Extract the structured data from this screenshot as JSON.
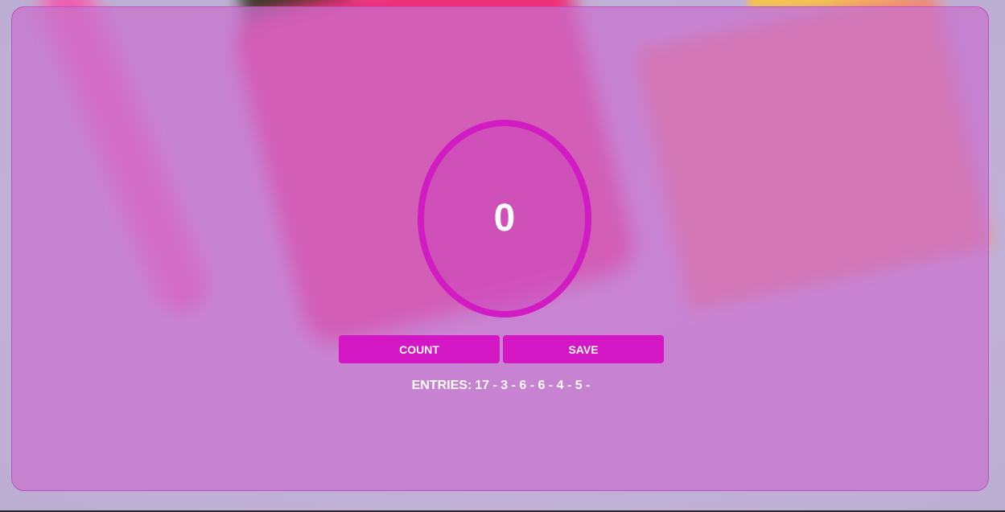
{
  "counter": {
    "value": "0"
  },
  "buttons": {
    "count_label": "COUNT",
    "save_label": "SAVE"
  },
  "entries": {
    "label": "ENTRIES:",
    "values": "17 - 3 - 6 - 6 - 4 - 5 -"
  },
  "colors": {
    "accent": "#d417c4",
    "panel": "#c870cd",
    "text": "#ffffff"
  }
}
